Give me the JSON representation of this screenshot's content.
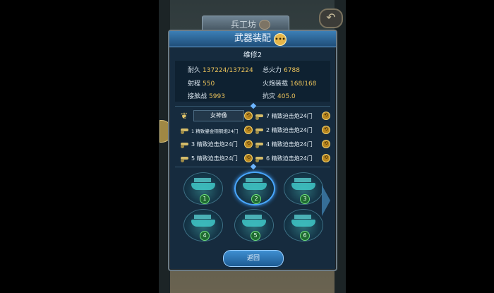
{
  "background": {
    "workshop_tab": "兵工坊"
  },
  "panel": {
    "title": "武器装配",
    "ship_name": "维修2",
    "stats": [
      {
        "label": "耐久",
        "value": "137224/137224"
      },
      {
        "label": "总火力",
        "value": "6788"
      },
      {
        "label": "射程",
        "value": "550"
      },
      {
        "label": "火炮装载",
        "value": "168/168"
      },
      {
        "label": "接舷战",
        "value": "5993"
      },
      {
        "label": "抗灾",
        "value": "405.0"
      }
    ],
    "figurehead": "女神像",
    "slots": [
      {
        "label": "7 精致迫击炮24门"
      },
      {
        "label": "1 精致鎏金铜钢炮24门"
      },
      {
        "label": "2 精致迫击炮24门"
      },
      {
        "label": "3 精致迫击炮24门"
      },
      {
        "label": "4 精致迫击炮24门"
      },
      {
        "label": "5 精致迫击炮24门"
      },
      {
        "label": "6 精致迫击炮24门"
      }
    ],
    "ships": [
      "1",
      "2",
      "3",
      "4",
      "5",
      "6"
    ],
    "return_label": "返回"
  },
  "colors": {
    "accent": "#3f8fd1",
    "value": "#e9c15a"
  }
}
